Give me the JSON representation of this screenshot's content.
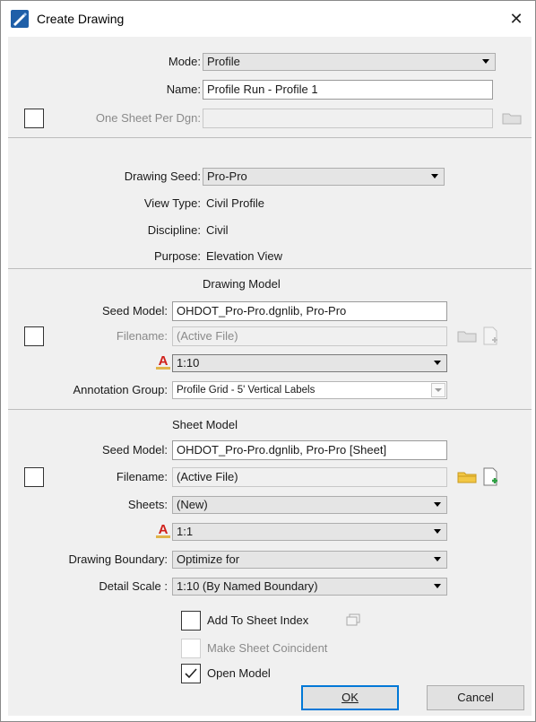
{
  "window": {
    "title": "Create Drawing"
  },
  "mode": {
    "label": "Mode:",
    "value": "Profile"
  },
  "name": {
    "label": "Name:",
    "value": "Profile Run - Profile 1"
  },
  "one_sheet": {
    "label": "One Sheet Per Dgn:",
    "value": ""
  },
  "drawing_seed": {
    "label": "Drawing Seed:",
    "value": "Pro-Pro"
  },
  "view_type": {
    "label": "View Type:",
    "value": "Civil Profile"
  },
  "discipline": {
    "label": "Discipline:",
    "value": "Civil"
  },
  "purpose": {
    "label": "Purpose:",
    "value": "Elevation View"
  },
  "drawing_model": {
    "heading": "Drawing Model",
    "seed_model_label": "Seed Model:",
    "seed_model_value": "OHDOT_Pro-Pro.dgnlib, Pro-Pro",
    "filename_label": "Filename:",
    "filename_value": "(Active File)",
    "scale_value": "1:10",
    "annotation_group_label": "Annotation Group:",
    "annotation_group_value": "Profile Grid - 5' Vertical Labels"
  },
  "sheet_model": {
    "heading": "Sheet Model",
    "seed_model_label": "Seed Model:",
    "seed_model_value": "OHDOT_Pro-Pro.dgnlib, Pro-Pro [Sheet]",
    "filename_label": "Filename:",
    "filename_value": "(Active File)",
    "sheets_label": "Sheets:",
    "sheets_value": "(New)",
    "scale_value": "1:1",
    "drawing_boundary_label": "Drawing Boundary:",
    "drawing_boundary_value": "Optimize for",
    "detail_scale_label": "Detail Scale :",
    "detail_scale_value": "1:10 (By Named Boundary)"
  },
  "options": {
    "add_to_sheet_index": "Add To Sheet Index",
    "make_sheet_coincident": "Make Sheet Coincident",
    "open_model": "Open Model",
    "open_model_checked": true
  },
  "buttons": {
    "ok": "OK",
    "cancel": "Cancel"
  },
  "icons": {
    "app": "create-drawing-icon",
    "folder": "folder-icon",
    "new_file": "new-file-icon",
    "annotation_scale": "annotation-scale-icon",
    "sheet_index": "sheet-index-icon"
  },
  "colors": {
    "accent": "#0078d7",
    "scale_red": "#d0201a",
    "folder_yellow": "#f2c744",
    "new_file_green": "#2ea043"
  }
}
